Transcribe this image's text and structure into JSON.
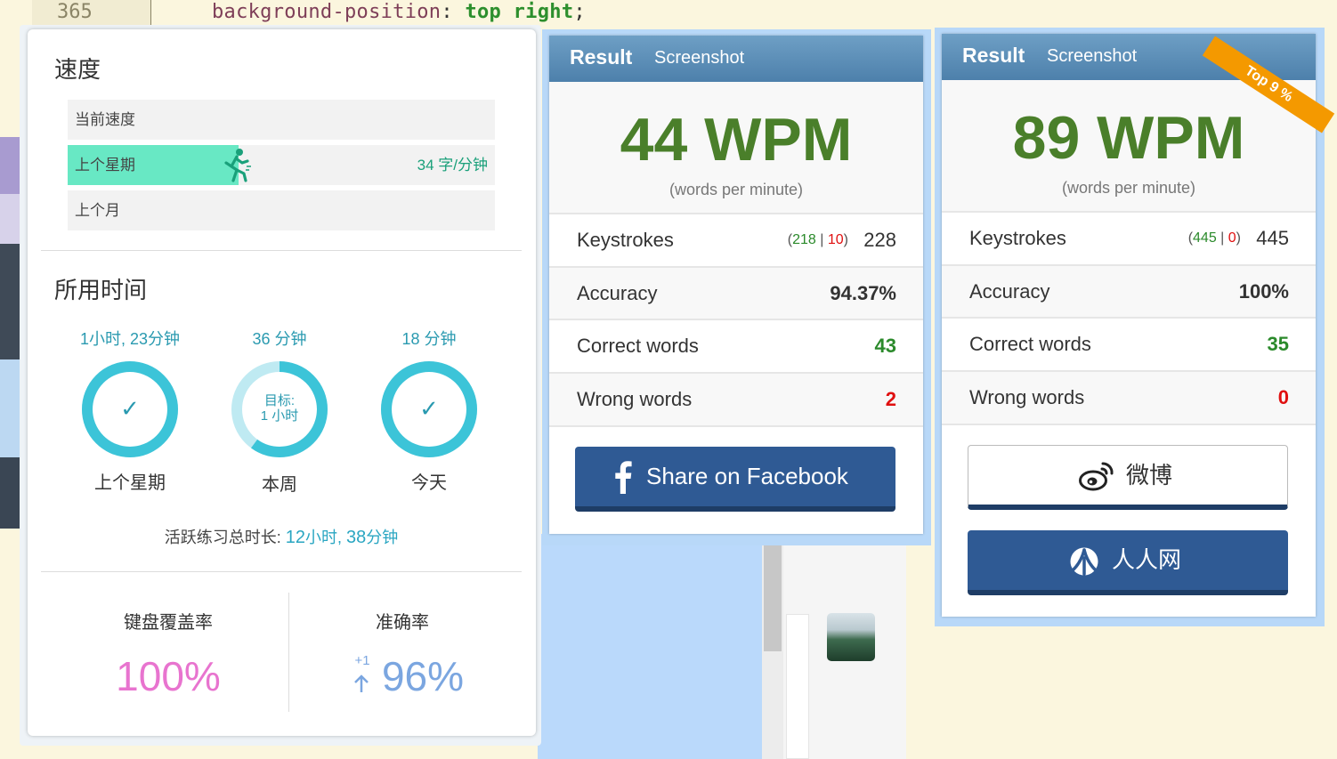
{
  "editor": {
    "line_number": "365",
    "code_property": "background-position",
    "code_colon": ":",
    "code_value_1": "top",
    "code_value_2": "right",
    "code_semicolon": ";"
  },
  "speed": {
    "title": "速度",
    "rows": [
      {
        "label": "当前速度",
        "value": ""
      },
      {
        "label": "上个星期",
        "value": "34 字/分钟",
        "fill_percent": 40
      },
      {
        "label": "上个月",
        "value": ""
      }
    ]
  },
  "time_used": {
    "title": "所用时间",
    "items": [
      {
        "value": "1小时, 23分钟",
        "label": "上个星期",
        "ring_text": "✓",
        "progress": 1.0
      },
      {
        "value": "36 分钟",
        "label": "本周",
        "ring_text_1": "目标:",
        "ring_text_2": "1 小时",
        "progress": 0.6
      },
      {
        "value": "18 分钟",
        "label": "今天",
        "ring_text": "✓",
        "progress": 1.0
      }
    ],
    "total_label": "活跃练习总时长:",
    "total_hours_num": "12",
    "total_hours_unit": "小时,",
    "total_minutes_num": "38",
    "total_minutes_unit": "分钟"
  },
  "metrics": {
    "coverage_label": "键盘覆盖率",
    "coverage_value": "100%",
    "accuracy_label": "准确率",
    "accuracy_delta": "+1",
    "accuracy_value": "96%"
  },
  "result_left": {
    "title": "Result",
    "subtitle": "Screenshot",
    "wpm": "44 WPM",
    "wpm_sub": "(words per minute)",
    "keystrokes_label": "Keystrokes",
    "keystrokes_correct": "218",
    "keystrokes_wrong": "10",
    "keystrokes_total": "228",
    "accuracy_label": "Accuracy",
    "accuracy_value": "94.37%",
    "correct_label": "Correct words",
    "correct_value": "43",
    "wrong_label": "Wrong words",
    "wrong_value": "2",
    "share_label": "Share on Facebook"
  },
  "result_right": {
    "title": "Result",
    "subtitle": "Screenshot",
    "ribbon": "Top 9 %",
    "wpm": "89 WPM",
    "wpm_sub": "(words per minute)",
    "keystrokes_label": "Keystrokes",
    "keystrokes_correct": "445",
    "keystrokes_wrong": "0",
    "keystrokes_total": "445",
    "accuracy_label": "Accuracy",
    "accuracy_value": "100%",
    "correct_label": "Correct words",
    "correct_value": "35",
    "wrong_label": "Wrong words",
    "wrong_value": "0",
    "weibo_label": "微博",
    "renren_label": "人人网"
  },
  "colors": {
    "accent_green": "#4a7f2a",
    "teal": "#2a9ab0",
    "ring": "#3cc4d8",
    "speed_fill": "#68e8c4",
    "header_blue": "#4d80ab",
    "button_blue": "#2f5a94",
    "pink": "#e874cf",
    "ribbon": "#f49900"
  },
  "icons": [
    "runner-icon",
    "check-icon",
    "arrow-up-icon",
    "facebook-icon",
    "weibo-icon",
    "renren-icon"
  ]
}
